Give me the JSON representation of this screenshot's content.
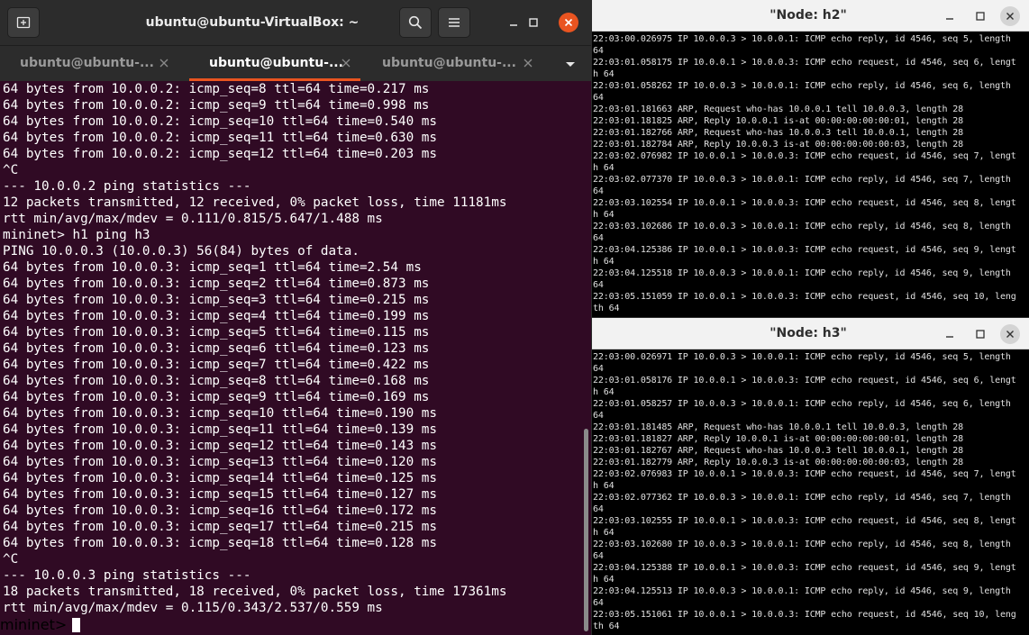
{
  "terminal": {
    "title": "ubuntu@ubuntu-VirtualBox: ~",
    "tabs": [
      {
        "label": "ubuntu@ubuntu-..."
      },
      {
        "label": "ubuntu@ubuntu-..."
      },
      {
        "label": "ubuntu@ubuntu-..."
      }
    ],
    "accent_color": "#e95420",
    "background_color": "#300a24",
    "icons": [
      "new-tab-icon",
      "search-icon",
      "hamburger-menu-icon",
      "minimize-icon",
      "maximize-icon",
      "close-icon",
      "chevron-down-icon"
    ],
    "lines": [
      "64 bytes from 10.0.0.2: icmp_seq=8 ttl=64 time=0.217 ms",
      "64 bytes from 10.0.0.2: icmp_seq=9 ttl=64 time=0.998 ms",
      "64 bytes from 10.0.0.2: icmp_seq=10 ttl=64 time=0.540 ms",
      "64 bytes from 10.0.0.2: icmp_seq=11 ttl=64 time=0.630 ms",
      "64 bytes from 10.0.0.2: icmp_seq=12 ttl=64 time=0.203 ms",
      "^C",
      "--- 10.0.0.2 ping statistics ---",
      "12 packets transmitted, 12 received, 0% packet loss, time 11181ms",
      "rtt min/avg/max/mdev = 0.111/0.815/5.647/1.488 ms",
      "mininet> h1 ping h3",
      "PING 10.0.0.3 (10.0.0.3) 56(84) bytes of data.",
      "64 bytes from 10.0.0.3: icmp_seq=1 ttl=64 time=2.54 ms",
      "64 bytes from 10.0.0.3: icmp_seq=2 ttl=64 time=0.873 ms",
      "64 bytes from 10.0.0.3: icmp_seq=3 ttl=64 time=0.215 ms",
      "64 bytes from 10.0.0.3: icmp_seq=4 ttl=64 time=0.199 ms",
      "64 bytes from 10.0.0.3: icmp_seq=5 ttl=64 time=0.115 ms",
      "64 bytes from 10.0.0.3: icmp_seq=6 ttl=64 time=0.123 ms",
      "64 bytes from 10.0.0.3: icmp_seq=7 ttl=64 time=0.422 ms",
      "64 bytes from 10.0.0.3: icmp_seq=8 ttl=64 time=0.168 ms",
      "64 bytes from 10.0.0.3: icmp_seq=9 ttl=64 time=0.169 ms",
      "64 bytes from 10.0.0.3: icmp_seq=10 ttl=64 time=0.190 ms",
      "64 bytes from 10.0.0.3: icmp_seq=11 ttl=64 time=0.139 ms",
      "64 bytes from 10.0.0.3: icmp_seq=12 ttl=64 time=0.143 ms",
      "64 bytes from 10.0.0.3: icmp_seq=13 ttl=64 time=0.120 ms",
      "64 bytes from 10.0.0.3: icmp_seq=14 ttl=64 time=0.125 ms",
      "64 bytes from 10.0.0.3: icmp_seq=15 ttl=64 time=0.127 ms",
      "64 bytes from 10.0.0.3: icmp_seq=16 ttl=64 time=0.172 ms",
      "64 bytes from 10.0.0.3: icmp_seq=17 ttl=64 time=0.215 ms",
      "64 bytes from 10.0.0.3: icmp_seq=18 ttl=64 time=0.128 ms",
      "^C",
      "--- 10.0.0.3 ping statistics ---",
      "18 packets transmitted, 18 received, 0% packet loss, time 17361ms",
      "rtt min/avg/max/mdev = 0.115/0.343/2.537/0.559 ms"
    ],
    "prompt": "mininet> "
  },
  "h2": {
    "title": "\"Node: h2\"",
    "lines": [
      "22:03:00.026975 IP 10.0.0.3 > 10.0.0.1: ICMP echo reply, id 4546, seq 5, length",
      "64",
      "22:03:01.058175 IP 10.0.0.1 > 10.0.0.3: ICMP echo request, id 4546, seq 6, lengt",
      "h 64",
      "22:03:01.058262 IP 10.0.0.3 > 10.0.0.1: ICMP echo reply, id 4546, seq 6, length",
      "64",
      "22:03:01.181663 ARP, Request who-has 10.0.0.1 tell 10.0.0.3, length 28",
      "22:03:01.181825 ARP, Reply 10.0.0.1 is-at 00:00:00:00:00:01, length 28",
      "22:03:01.182766 ARP, Request who-has 10.0.0.3 tell 10.0.0.1, length 28",
      "22:03:01.182784 ARP, Reply 10.0.0.3 is-at 00:00:00:00:00:03, length 28",
      "22:03:02.076982 IP 10.0.0.1 > 10.0.0.3: ICMP echo request, id 4546, seq 7, lengt",
      "h 64",
      "22:03:02.077370 IP 10.0.0.3 > 10.0.0.1: ICMP echo reply, id 4546, seq 7, length",
      "64",
      "22:03:03.102554 IP 10.0.0.1 > 10.0.0.3: ICMP echo request, id 4546, seq 8, lengt",
      "h 64",
      "22:03:03.102686 IP 10.0.0.3 > 10.0.0.1: ICMP echo reply, id 4546, seq 8, length",
      "64",
      "22:03:04.125386 IP 10.0.0.1 > 10.0.0.3: ICMP echo request, id 4546, seq 9, lengt",
      "h 64",
      "22:03:04.125518 IP 10.0.0.3 > 10.0.0.1: ICMP echo reply, id 4546, seq 9, length",
      "64",
      "22:03:05.151059 IP 10.0.0.1 > 10.0.0.3: ICMP echo request, id 4546, seq 10, leng",
      "th 64"
    ]
  },
  "h3": {
    "title": "\"Node: h3\"",
    "lines": [
      "22:03:00.026971 IP 10.0.0.3 > 10.0.0.1: ICMP echo reply, id 4546, seq 5, length",
      "64",
      "22:03:01.058176 IP 10.0.0.1 > 10.0.0.3: ICMP echo request, id 4546, seq 6, lengt",
      "h 64",
      "22:03:01.058257 IP 10.0.0.3 > 10.0.0.1: ICMP echo reply, id 4546, seq 6, length",
      "64",
      "22:03:01.181485 ARP, Request who-has 10.0.0.1 tell 10.0.0.3, length 28",
      "22:03:01.181827 ARP, Reply 10.0.0.1 is-at 00:00:00:00:00:01, length 28",
      "22:03:01.182767 ARP, Request who-has 10.0.0.3 tell 10.0.0.1, length 28",
      "22:03:01.182779 ARP, Reply 10.0.0.3 is-at 00:00:00:00:00:03, length 28",
      "22:03:02.076983 IP 10.0.0.1 > 10.0.0.3: ICMP echo request, id 4546, seq 7, lengt",
      "h 64",
      "22:03:02.077362 IP 10.0.0.3 > 10.0.0.1: ICMP echo reply, id 4546, seq 7, length",
      "64",
      "22:03:03.102555 IP 10.0.0.1 > 10.0.0.3: ICMP echo request, id 4546, seq 8, lengt",
      "h 64",
      "22:03:03.102680 IP 10.0.0.3 > 10.0.0.1: ICMP echo reply, id 4546, seq 8, length",
      "64",
      "22:03:04.125388 IP 10.0.0.1 > 10.0.0.3: ICMP echo request, id 4546, seq 9, lengt",
      "h 64",
      "22:03:04.125513 IP 10.0.0.3 > 10.0.0.1: ICMP echo reply, id 4546, seq 9, length",
      "64",
      "22:03:05.151061 IP 10.0.0.1 > 10.0.0.3: ICMP echo request, id 4546, seq 10, leng",
      "th 64"
    ]
  }
}
